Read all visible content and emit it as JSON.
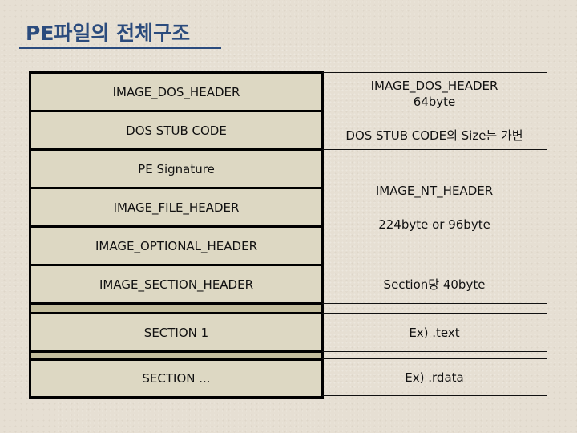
{
  "title": "PE파일의 전체구조",
  "structure": {
    "rows": [
      {
        "label": "IMAGE_DOS_HEADER"
      },
      {
        "label": "DOS STUB CODE"
      },
      {
        "label": "PE Signature"
      },
      {
        "label": "IMAGE_FILE_HEADER"
      },
      {
        "label": "IMAGE_OPTIONAL_HEADER"
      },
      {
        "label": "IMAGE_SECTION_HEADER"
      },
      {
        "label": "SECTION 1"
      },
      {
        "label": "SECTION ..."
      }
    ]
  },
  "descriptions": {
    "dos_header": {
      "line1": "IMAGE_DOS_HEADER",
      "line2": "64byte"
    },
    "dos_stub": {
      "line1": "DOS STUB CODE의 Size는 가변"
    },
    "nt_header": {
      "line1": "IMAGE_NT_HEADER",
      "line2": "224byte or 96byte"
    },
    "section_header": {
      "line1": "Section당 40byte"
    },
    "section1": {
      "line1": "Ex) .text"
    },
    "section_more": {
      "line1": "Ex) .rdata"
    }
  },
  "colors": {
    "title": "#2b4b7d",
    "background": "#e6dfd3",
    "box_fill": "#ddd8c3",
    "band_fill": "#c3bd9d"
  }
}
